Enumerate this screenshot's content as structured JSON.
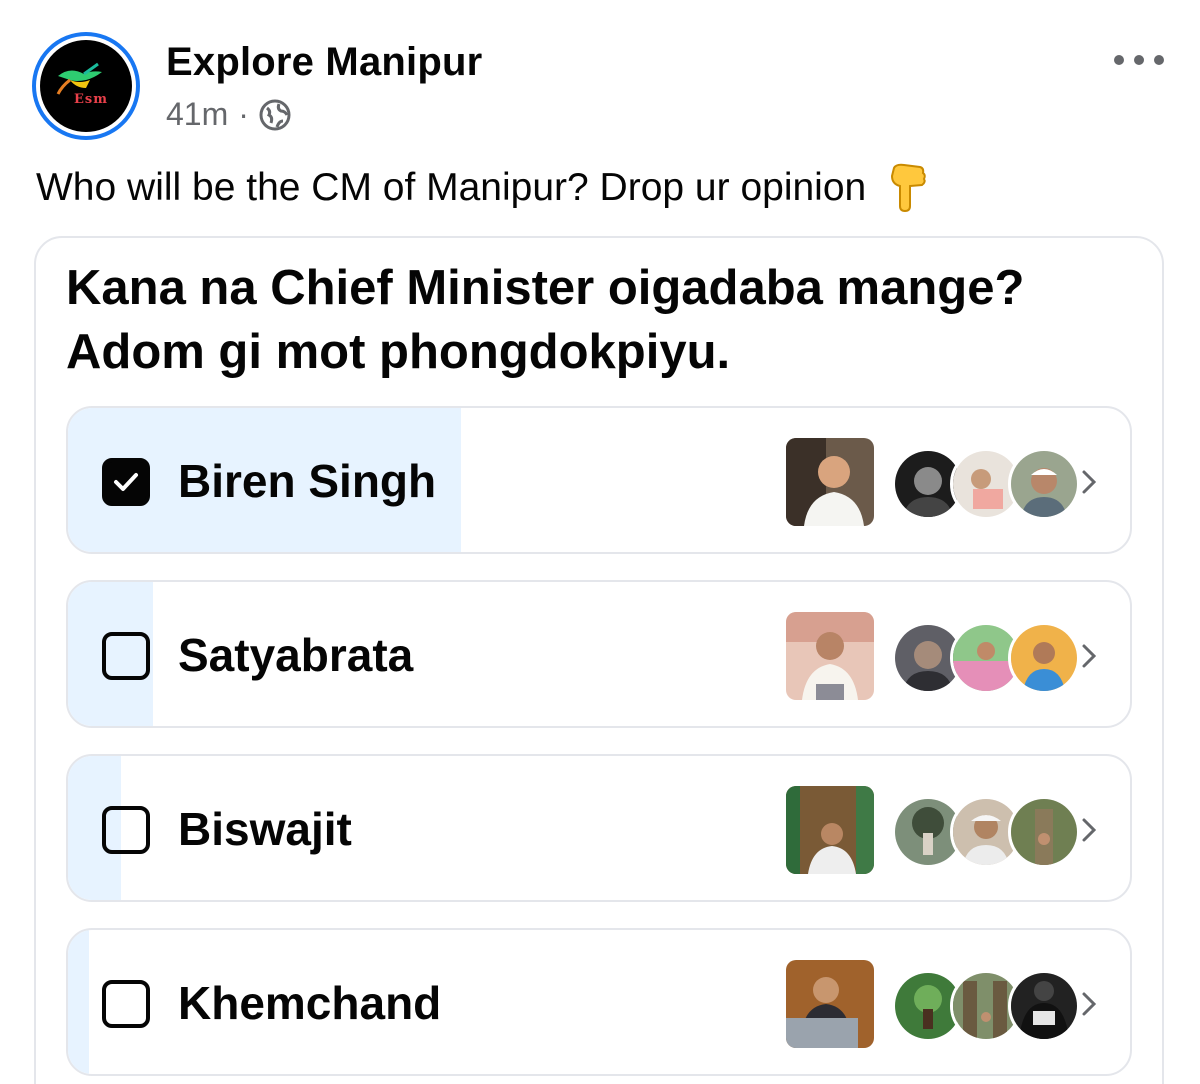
{
  "header": {
    "page_name": "Explore Manipur",
    "timestamp": "41m",
    "separator": "·",
    "privacy_icon": "globe-icon",
    "more_icon": "more-options-icon",
    "logo_text": "Esm"
  },
  "post": {
    "caption": "Who will be the CM of Manipur? Drop ur opinion",
    "caption_emoji": "pointing-down-icon"
  },
  "poll": {
    "question": "Kana na Chief Minister oigadaba mange? Adom gi mot phongdokpiyu.",
    "options": [
      {
        "label": "Biren Singh",
        "selected": true,
        "vote_share": 0.37
      },
      {
        "label": "Satyabrata",
        "selected": false,
        "vote_share": 0.08
      },
      {
        "label": "Biswajit",
        "selected": false,
        "vote_share": 0.05
      },
      {
        "label": "Khemchand",
        "selected": false,
        "vote_share": 0.02
      }
    ]
  },
  "colors": {
    "accent": "#1877f2",
    "fill": "#e7f3ff",
    "border": "#e4e6eb",
    "muted_text": "#65676b"
  }
}
